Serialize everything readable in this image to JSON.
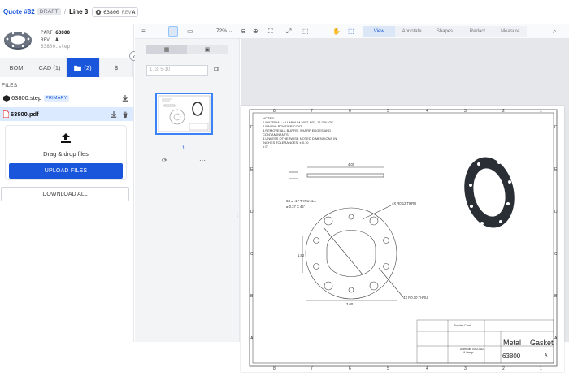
{
  "breadcrumb": {
    "quote": "Quote #82",
    "status": "DRAFT",
    "separator": "/",
    "line": "Line 3",
    "part_number": "63800",
    "rev_label": "REV",
    "rev_value": "A"
  },
  "part": {
    "part_label": "PART",
    "part_number": "63800",
    "rev_label": "REV",
    "rev_value": "A",
    "filename": "63800.step"
  },
  "tabs": [
    {
      "label": "BOM"
    },
    {
      "label": "CAD (1)"
    },
    {
      "label": "(2)"
    },
    {
      "label": "$"
    }
  ],
  "files": {
    "heading": "FILES",
    "items": [
      {
        "name": "63800.step",
        "badge": "PRIMARY"
      },
      {
        "name": "63800.pdf",
        "badge": ""
      }
    ],
    "dropzone_text": "Drag & drop files",
    "upload_label": "UPLOAD FILES",
    "download_all_label": "DOWNLOAD ALL"
  },
  "viewer": {
    "zoom": "72%",
    "modes": [
      "View",
      "Annotate",
      "Shapes",
      "Redact",
      "Measure"
    ],
    "active_mode": "View",
    "page_range_placeholder": "1, 3, 5-10",
    "current_page": "1"
  },
  "drawing": {
    "col_labels": [
      "8",
      "7",
      "6",
      "5",
      "4",
      "3",
      "2",
      "1"
    ],
    "row_labels": [
      "F",
      "E",
      "D",
      "C",
      "B",
      "A"
    ],
    "notes": [
      "NOTES:",
      "1.MATERIAL: ALUMINUM 5052-H32, 11 GAUGE",
      "2.FINISH: POWDER COAT",
      "3.REMOVE ALL BURRS, SHARP EDGES AND",
      "CONTAMINANTS.",
      "4.UNLESS OTHERWISE NOTED DIMENSIONS IN",
      "INCHES TOLERANCES: ± 0.10",
      "± 0°"
    ],
    "dim_thickness": "4.00",
    "hole_callout_1": "6X ⌀ .17 THRU ALL",
    "hole_callout_2": "⌀ 0.37 X 45°",
    "radius_callout_1": "4X R0.13 THRU",
    "radius_callout_2": "4X R0.10 THRU",
    "dim_width": "3.00",
    "dim_height": "1.82",
    "title_finish": "Powder Coat",
    "title_material": "Aluminum 5052-H32",
    "title_gauge": "11 Gauge",
    "title_name_1": "Metal",
    "title_name_2": "Gasket",
    "title_number": "63800",
    "title_rev": "A"
  }
}
